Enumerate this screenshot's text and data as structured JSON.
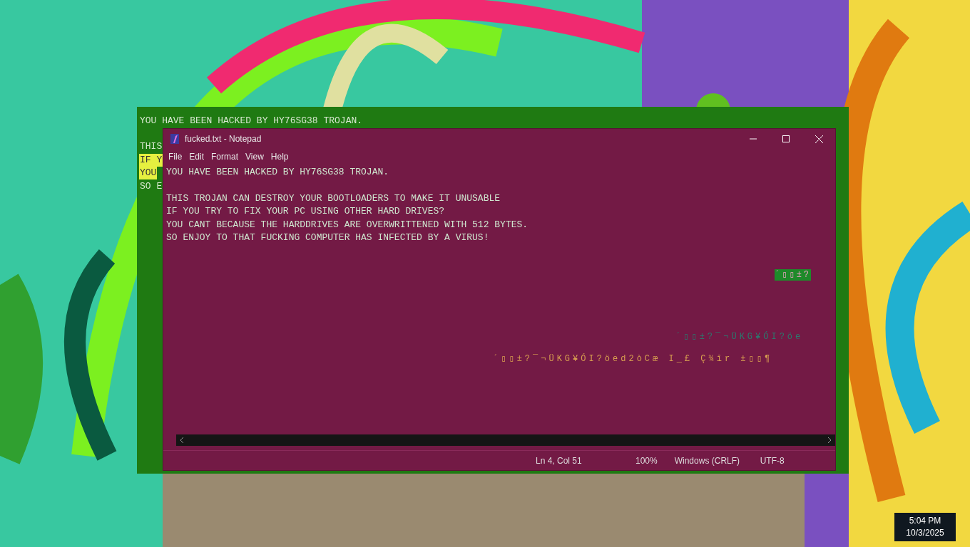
{
  "console": {
    "title_line": "YOU HAVE BEEN HACKED BY HY76SG38 TROJAN.",
    "partial_lines": [
      {
        "text": "THIS",
        "highlighted": false
      },
      {
        "text": "IF Y",
        "highlighted": true
      },
      {
        "text": "YOU",
        "highlighted": true
      },
      {
        "text": "SO E",
        "highlighted": false
      }
    ]
  },
  "notepad": {
    "title": "fucked.txt - Notepad",
    "menu": [
      "File",
      "Edit",
      "Format",
      "View",
      "Help"
    ],
    "paragraphs": [
      [
        "YOU HAVE BEEN HACKED BY HY76SG38 TROJAN."
      ],
      [
        "THIS TROJAN CAN DESTROY YOUR BOOTLOADERS TO MAKE IT UNUSABLE",
        "IF YOU TRY TO FIX YOUR PC USING OTHER HARD DRIVES?",
        "YOU CANT BECAUSE THE HARDDRIVES ARE OVERWRITTENED WITH 512 BYTES.",
        "SO ENJOY TO THAT FUCKING COMPUTER HAS INFECTED BY A VIRUS!"
      ]
    ],
    "status": {
      "position": "Ln 4, Col 51",
      "zoom": "100%",
      "line_ending": "Windows (CRLF)",
      "encoding": "UTF-8"
    }
  },
  "glitch_text": [
    {
      "text": "´▯▯±?",
      "color": "#1e8a2a"
    },
    {
      "text": "´▯▯±?¯¬ÜKG¥ÓI?öe",
      "color": "#2a7a6e"
    },
    {
      "text": "´▯▯±?¯¬ÜKG¥ÓI?öed2òCæ I_£ Ç¾îr ±▯▯¶",
      "color": "#d9a050"
    }
  ],
  "clock": {
    "time": "5:04 PM",
    "date": "10/3/2025"
  }
}
